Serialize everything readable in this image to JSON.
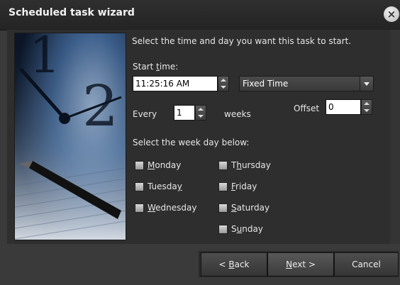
{
  "window": {
    "title": "Scheduled task wizard",
    "close_glyph": "×"
  },
  "prompt": "Select the time and day you want this task to start.",
  "start_time": {
    "label_pre": "Start ",
    "label_ul": "t",
    "label_post": "ime:",
    "value": "11:25:16 AM",
    "mode": "Fixed Time"
  },
  "every": {
    "label": "Every",
    "value": "1",
    "unit": "weeks"
  },
  "offset": {
    "label": "Offset",
    "value": "0"
  },
  "weekday_prompt": "Select the week day below:",
  "days": [
    {
      "pre": "",
      "ul": "M",
      "post": "onday"
    },
    {
      "pre": "Tuesda",
      "ul": "y",
      "post": ""
    },
    {
      "pre": "",
      "ul": "W",
      "post": "ednesday"
    },
    {
      "pre": "T",
      "ul": "h",
      "post": "ursday"
    },
    {
      "pre": "",
      "ul": "F",
      "post": "riday"
    },
    {
      "pre": "",
      "ul": "S",
      "post": "aturday"
    },
    {
      "pre": "S",
      "ul": "u",
      "post": "nday"
    }
  ],
  "buttons": {
    "back": {
      "pre": "< ",
      "ul": "B",
      "post": "ack"
    },
    "next": {
      "pre": "",
      "ul": "N",
      "post": "ext >"
    },
    "cancel": "Cancel"
  },
  "icons": {
    "close": "close-icon",
    "image": "clock-and-pen-photo"
  },
  "colors": {
    "window_bg": "#2e2e2e",
    "title_bg": "#2a2a2a",
    "text": "#e6e6e6"
  }
}
